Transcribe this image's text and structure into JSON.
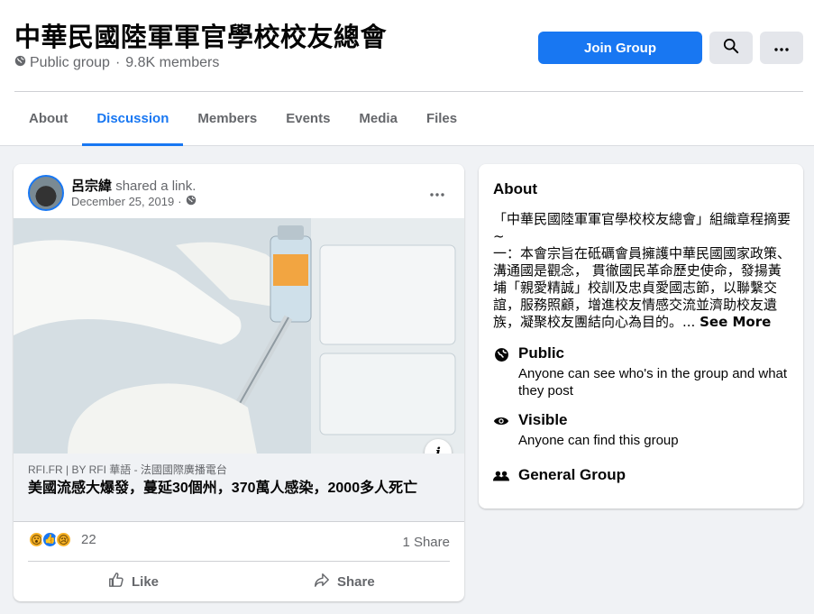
{
  "header": {
    "group_name": "中華民國陸軍軍官學校校友總會",
    "privacy": "Public group",
    "separator": "·",
    "members": "9.8K members",
    "join_label": "Join Group"
  },
  "tabs": [
    {
      "label": "About"
    },
    {
      "label": "Discussion"
    },
    {
      "label": "Members"
    },
    {
      "label": "Events"
    },
    {
      "label": "Media"
    },
    {
      "label": "Files"
    }
  ],
  "active_tab": "Discussion",
  "post": {
    "author": "呂宗緯",
    "action": "shared a link.",
    "date": "December 25, 2019",
    "date_separator": "·",
    "link": {
      "source": "RFI.FR | BY RFI 華語 - 法國國際廣播電台",
      "headline": "美國流感大爆發，蔓延30個州，370萬人感染，2000多人死亡"
    },
    "reaction_count": "22",
    "share_count": "1 Share",
    "like_label": "Like",
    "share_label": "Share"
  },
  "about": {
    "title": "About",
    "description": "「中華民國陸軍軍官學校校友總會」組織章程摘要~\n一：本會宗旨在砥礪會員擁護中華民國國家政策、溝通國是觀念， 貫徹國民革命歷史使命，發揚黃埔「親愛精誠」校訓及忠貞愛國志節，以聯繫交誼，服務照顧，增進校友情感交流並濟助校友遺族，凝聚校友團結向心為目的。...",
    "see_more": "See More",
    "items": [
      {
        "icon": "globe-icon",
        "title": "Public",
        "desc": "Anyone can see who's in the group and what they post"
      },
      {
        "icon": "eye-icon",
        "title": "Visible",
        "desc": "Anyone can find this group"
      },
      {
        "icon": "people-icon",
        "title": "General Group",
        "desc": ""
      }
    ]
  },
  "colors": {
    "accent": "#1877f2",
    "background": "#f0f2f5",
    "secondary_text": "#65676b"
  }
}
